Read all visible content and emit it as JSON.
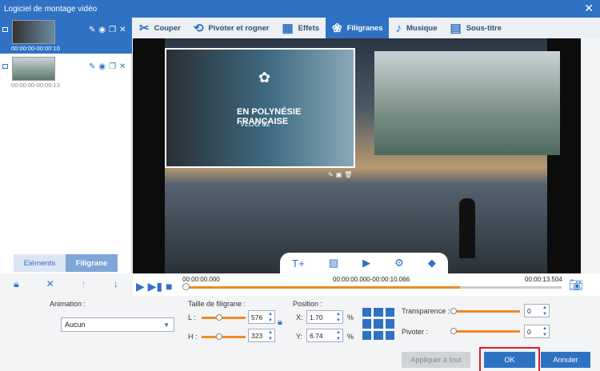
{
  "window": {
    "title": "Logiciel de montage vidéo"
  },
  "clips": [
    {
      "time": "00:00:00-00:00:10"
    },
    {
      "time": "00:00:00-00:00:13"
    }
  ],
  "left_tabs": {
    "elements": "Eléments",
    "filigrane": "Filigrane"
  },
  "tabs": [
    {
      "label": "Couper",
      "icon": "cut-icon"
    },
    {
      "label": "Pivoter et rogner",
      "icon": "crop-icon"
    },
    {
      "label": "Effets",
      "icon": "effects-icon"
    },
    {
      "label": "Filigranes",
      "icon": "watermark-icon"
    },
    {
      "label": "Musique",
      "icon": "music-icon"
    },
    {
      "label": "Sous-titre",
      "icon": "subtitle-icon"
    }
  ],
  "preview": {
    "wm_text1": "EN POLYNÉSIE FRANÇAISE",
    "wm_text2": "VLOG 02"
  },
  "timeline": {
    "current": "00:00:00.000",
    "range": "00:00:00.000-00:00:10.066",
    "total": "00:00:13.504",
    "progress": 0.73
  },
  "settings": {
    "animation_label": "Animation :",
    "animation_value": "Aucun",
    "size_label": "Taille de filigrane :",
    "L_label": "L :",
    "L_value": "576",
    "H_label": "H :",
    "H_value": "323",
    "position_label": "Position :",
    "X_label": "X:",
    "X_value": "1.70",
    "Y_label": "Y:",
    "Y_value": "6.74",
    "pct": "%",
    "transparence_label": "Transparence :",
    "transparence_value": "0",
    "pivoter_label": "Pivoter :",
    "pivoter_value": "0"
  },
  "buttons": {
    "apply": "Appliquer à tout",
    "ok": "OK",
    "cancel": "Annuler"
  }
}
